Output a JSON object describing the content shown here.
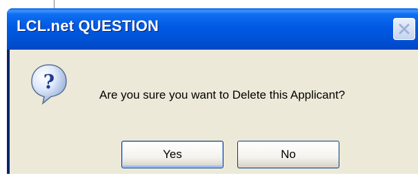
{
  "dialog": {
    "title": "LCL.net QUESTION",
    "message": "Are you sure you want to Delete this Applicant?",
    "icon": "question-icon",
    "close_icon": "close-icon"
  },
  "buttons": {
    "yes_label": "Yes",
    "no_label": "No"
  },
  "colors": {
    "titlebar": "#0054d8",
    "body": "#ece9d8",
    "button_border": "#003c74"
  }
}
